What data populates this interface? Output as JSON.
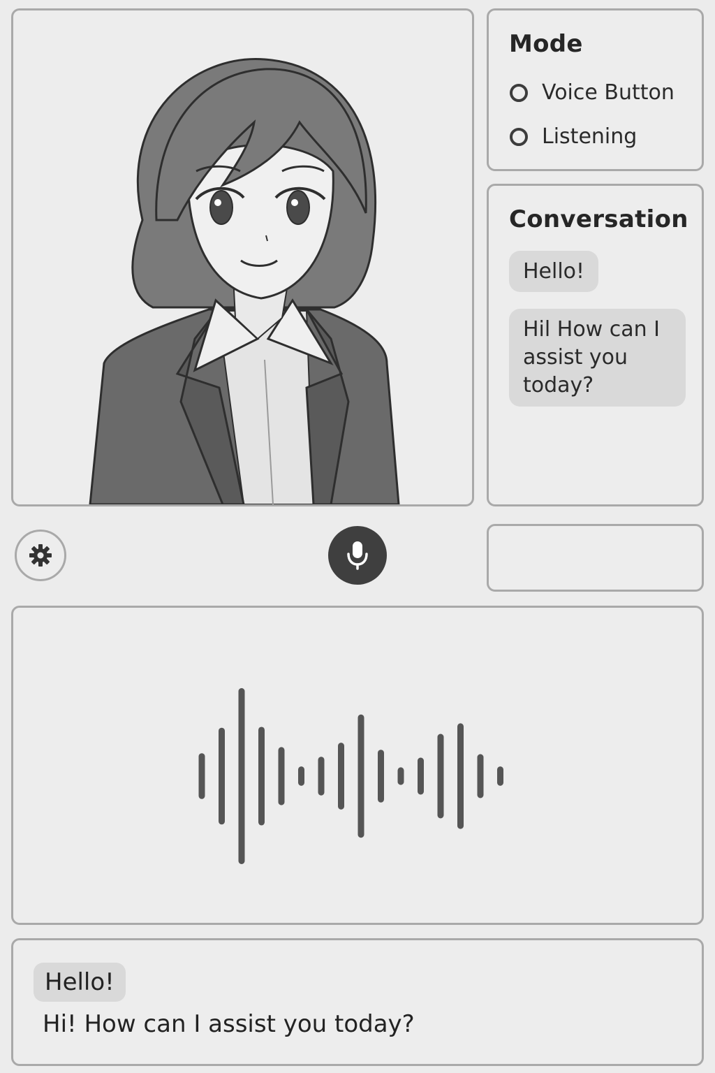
{
  "mode": {
    "title": "Mode",
    "options": [
      {
        "label": "Voice Button",
        "selected": false
      },
      {
        "label": "Listening",
        "selected": false
      }
    ]
  },
  "conversation": {
    "title": "Conversation",
    "messages": [
      {
        "role": "user",
        "text": "Hello!"
      },
      {
        "role": "assistant",
        "text": "Hil How can I assist you today?"
      }
    ]
  },
  "controls": {
    "settings_icon": "gear-icon",
    "mic_icon": "microphone-icon",
    "text_input_value": ""
  },
  "waveform": {
    "bar_levels": [
      0.26,
      0.55,
      1.0,
      0.56,
      0.33,
      0.11,
      0.22,
      0.38,
      0.7,
      0.3,
      0.1,
      0.21,
      0.48,
      0.6,
      0.25,
      0.11
    ]
  },
  "transcript": {
    "user_text": "Hello!",
    "assistant_text": "Hi! How can I assist you today?"
  },
  "colors": {
    "background": "#ececec",
    "panel_border": "#a9a9a9",
    "bubble": "#d9d9d9",
    "mic_button": "#3f3f3f",
    "waveform": "#555555"
  }
}
